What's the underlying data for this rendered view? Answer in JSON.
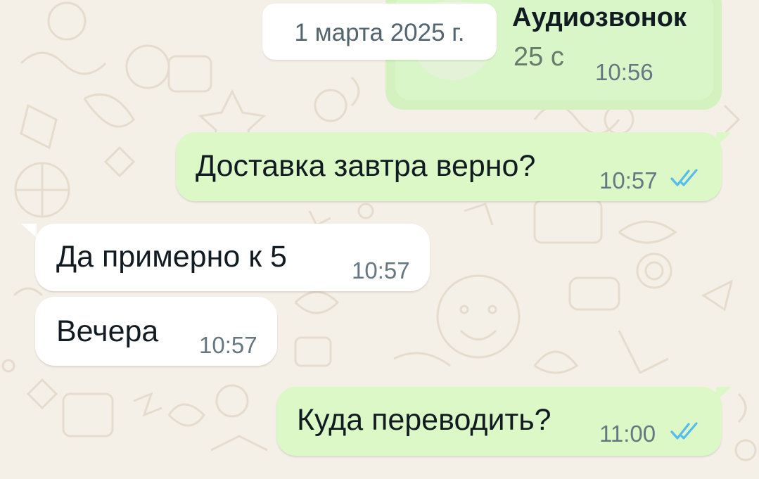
{
  "call": {
    "title": "Аудиозвонок",
    "duration": "25 с",
    "time": "10:56"
  },
  "date_separator": "1 марта 2025 г.",
  "messages": [
    {
      "direction": "outgoing",
      "text": "Доставка завтра верно?",
      "time": "10:57",
      "status_icon": "double-check-read-icon"
    },
    {
      "direction": "incoming",
      "text": "Да примерно к 5",
      "time": "10:57"
    },
    {
      "direction": "incoming",
      "text": "Вечера",
      "time": "10:57"
    },
    {
      "direction": "outgoing",
      "text": "Куда переводить?",
      "time": "11:00",
      "status_icon": "double-check-read-icon"
    }
  ],
  "colors": {
    "outgoing_bubble": "#dcf8c6",
    "incoming_bubble": "#ffffff",
    "wallpaper": "#f4efe7",
    "read_ticks": "#53bdeb",
    "time_text": "#667781"
  }
}
